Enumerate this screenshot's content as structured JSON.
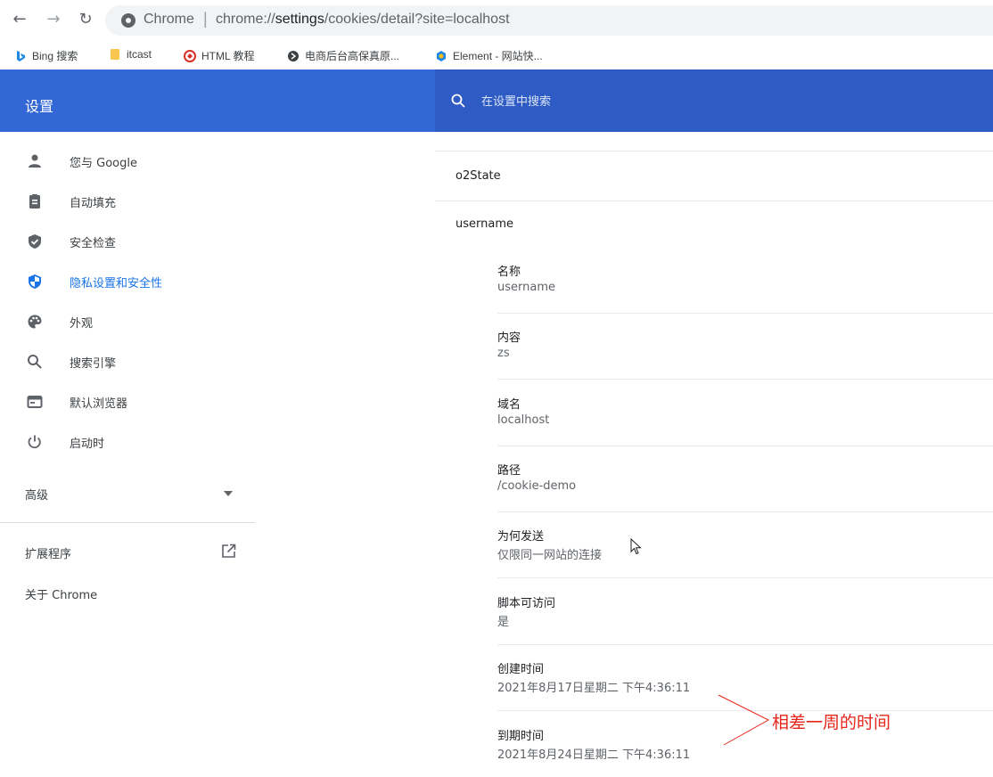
{
  "addressbar": {
    "back_icon": "arrow-left-icon",
    "forward_icon": "arrow-right-icon",
    "reload_icon": "reload-icon",
    "chrome_label": "Chrome",
    "separator": "|",
    "url_prefix": "chrome://",
    "url_host": "settings",
    "url_suffix": "/cookies/detail?site=localhost"
  },
  "bookmarks": [
    {
      "label": "Bing 搜索",
      "icon": "bing-icon",
      "color": "#1e88e5"
    },
    {
      "label": "itcast",
      "icon": "folder-icon",
      "color": "#f9c74f"
    },
    {
      "label": "HTML 教程",
      "icon": "runoob-icon",
      "color": "#d93025"
    },
    {
      "label": "电商后台高保真原...",
      "icon": "globe-icon",
      "color": "#3c4043"
    },
    {
      "label": "Element - 网站快...",
      "icon": "element-icon",
      "color": "#1e88e5"
    }
  ],
  "header": {
    "title": "设置",
    "search_placeholder": "在设置中搜索"
  },
  "sidebar": {
    "items": [
      {
        "label": "您与 Google",
        "icon": "person-icon"
      },
      {
        "label": "自动填充",
        "icon": "clipboard-icon"
      },
      {
        "label": "安全检查",
        "icon": "shield-check-icon"
      },
      {
        "label": "隐私设置和安全性",
        "icon": "shield-icon",
        "active": true
      },
      {
        "label": "外观",
        "icon": "palette-icon"
      },
      {
        "label": "搜索引擎",
        "icon": "search-icon"
      },
      {
        "label": "默认浏览器",
        "icon": "browser-icon"
      },
      {
        "label": "启动时",
        "icon": "power-icon"
      }
    ],
    "advanced": "高级",
    "extensions": "扩展程序",
    "about": "关于 Chrome"
  },
  "cookies": {
    "row1": "o2State",
    "row2": "username",
    "details": [
      {
        "label": "名称",
        "value": "username"
      },
      {
        "label": "内容",
        "value": "zs"
      },
      {
        "label": "域名",
        "value": "localhost"
      },
      {
        "label": "路径",
        "value": "/cookie-demo"
      },
      {
        "label": "为何发送",
        "value": "仅限同一网站的连接"
      },
      {
        "label": "脚本可访问",
        "value": "是"
      },
      {
        "label": "创建时间",
        "value": "2021年8月17日星期二 下午4:36:11"
      },
      {
        "label": "到期时间",
        "value": "2021年8月24日星期二 下午4:36:11"
      }
    ]
  },
  "annotation": {
    "text": "相差一周的时间",
    "color": "#e8251a"
  },
  "colors": {
    "header_blue": "#3367d6",
    "active_blue": "#1a73e8"
  }
}
